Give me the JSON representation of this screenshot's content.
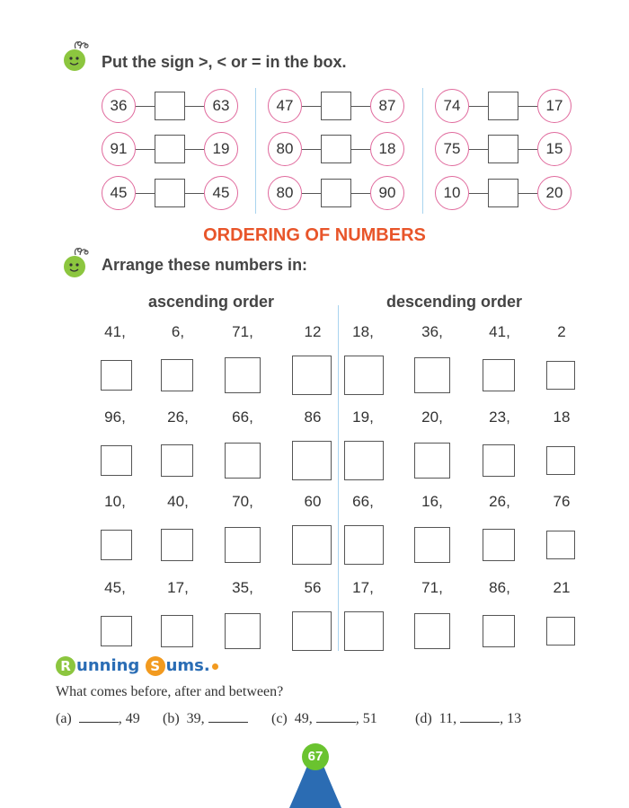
{
  "compare": {
    "instruction": "Put the sign >, <  or = in the box.",
    "groups": [
      [
        [
          "36",
          "63"
        ],
        [
          "91",
          "19"
        ],
        [
          "45",
          "45"
        ]
      ],
      [
        [
          "47",
          "87"
        ],
        [
          "80",
          "18"
        ],
        [
          "80",
          "90"
        ]
      ],
      [
        [
          "74",
          "17"
        ],
        [
          "75",
          "15"
        ],
        [
          "10",
          "20"
        ]
      ]
    ]
  },
  "ordering": {
    "heading": "ORDERING OF NUMBERS",
    "instruction": "Arrange these numbers in:",
    "ascending_label": "ascending order",
    "descending_label": "descending order",
    "rows": [
      {
        "asc": [
          "41,",
          "6,",
          "71,",
          "12"
        ],
        "desc": [
          "18,",
          "36,",
          "41,",
          "2"
        ]
      },
      {
        "asc": [
          "96,",
          "26,",
          "66,",
          "86"
        ],
        "desc": [
          "19,",
          "20,",
          "23,",
          "18"
        ]
      },
      {
        "asc": [
          "10,",
          "40,",
          "70,",
          "60"
        ],
        "desc": [
          "66,",
          "16,",
          "26,",
          "76"
        ]
      },
      {
        "asc": [
          "45,",
          "17,",
          "35,",
          "56"
        ],
        "desc": [
          "17,",
          "71,",
          "86,",
          "21"
        ]
      }
    ]
  },
  "running_sums": {
    "title_r": "R",
    "title_rest1": "unning ",
    "title_s": "S",
    "title_rest2": "ums.",
    "question": "What comes before, after and between?",
    "items": [
      {
        "label": "(a)",
        "pre": "",
        "post": ", 49"
      },
      {
        "label": "(b)",
        "pre": "39, ",
        "post": ""
      },
      {
        "label": "(c)",
        "pre": "49, ",
        "post": ", 51"
      },
      {
        "label": "(d)",
        "pre": "11, ",
        "post": ", 13"
      }
    ]
  },
  "page_number": "67",
  "colors": {
    "heading": "#e8552a",
    "circle_border": "#e06a9d",
    "separator": "#a9d4ef",
    "bug": "#8cc63f",
    "page_badge": "#6ac32f",
    "mountain": "#2b6cb3"
  }
}
